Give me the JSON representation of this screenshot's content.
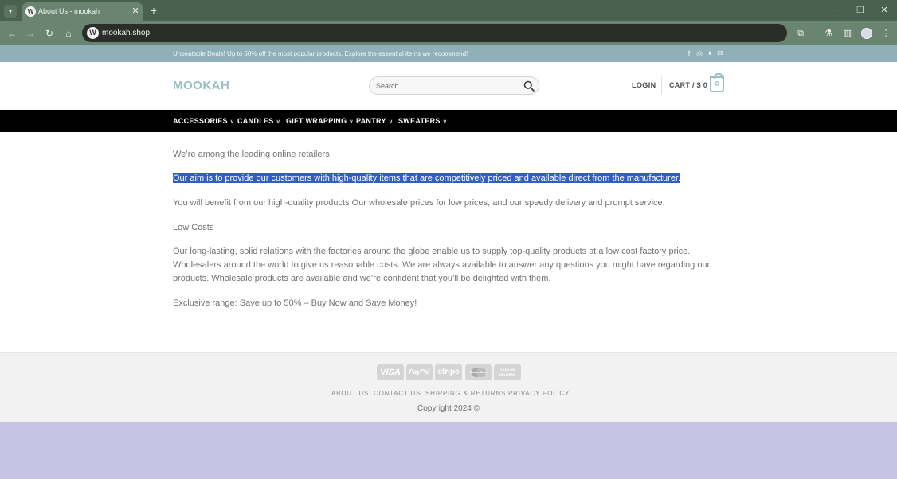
{
  "browser": {
    "tab_title": "About Us - mookah",
    "tab_favicon": "W",
    "url": "mookah.shop"
  },
  "site": {
    "topbar_text": "Unbeatable Deals! Up to 50% off the most popular products. Explore the essential items we recommend!",
    "logo": "MOOKAH",
    "search_placeholder": "Search…",
    "login_label": "LOGIN",
    "cart_label": "CART / $ 0",
    "cart_count": "0",
    "nav": [
      {
        "label": "ACCESSORIES"
      },
      {
        "label": "CANDLES"
      },
      {
        "label": "GIFT WRAPPING"
      },
      {
        "label": "PANTRY"
      },
      {
        "label": "SWEATERS"
      }
    ],
    "paragraphs": [
      "We’re among the leading online retailers.",
      "Our aim is to provide our customers with high-quality items that are competitively priced and available direct from the manufacturer.",
      "You will benefit from our high-quality products Our wholesale prices for low prices, and our speedy delivery and prompt service.",
      "Low Costs",
      "Our long-lasting, solid relations with the factories around the globe enable us to supply top-quality products at a low cost factory price. Wholesalers around the world to give us reasonable costs. We are always available to answer any questions you might have regarding our products. Wholesale products are available and we’re confident that you’ll be delighted with them.",
      "Exclusive range: Save up to 50% – Buy Now and Save Money!"
    ],
    "payments": {
      "visa": "VISA",
      "paypal": "PayPal",
      "stripe": "stripe",
      "mastercard": "MasterCard",
      "cod": "CASH ON DELIVERY"
    },
    "footer_links": [
      "ABOUT US",
      "CONTACT US",
      "SHIPPING & RETURNS",
      "PRIVACY POLICY"
    ],
    "copyright": "Copyright 2024 ©"
  },
  "colors": {
    "accent": "#9bbec7",
    "topbar": "#8fb0b8",
    "nav_bg": "#000000",
    "selection": "#2f5fc4",
    "browser_frame": "#6a8472"
  }
}
